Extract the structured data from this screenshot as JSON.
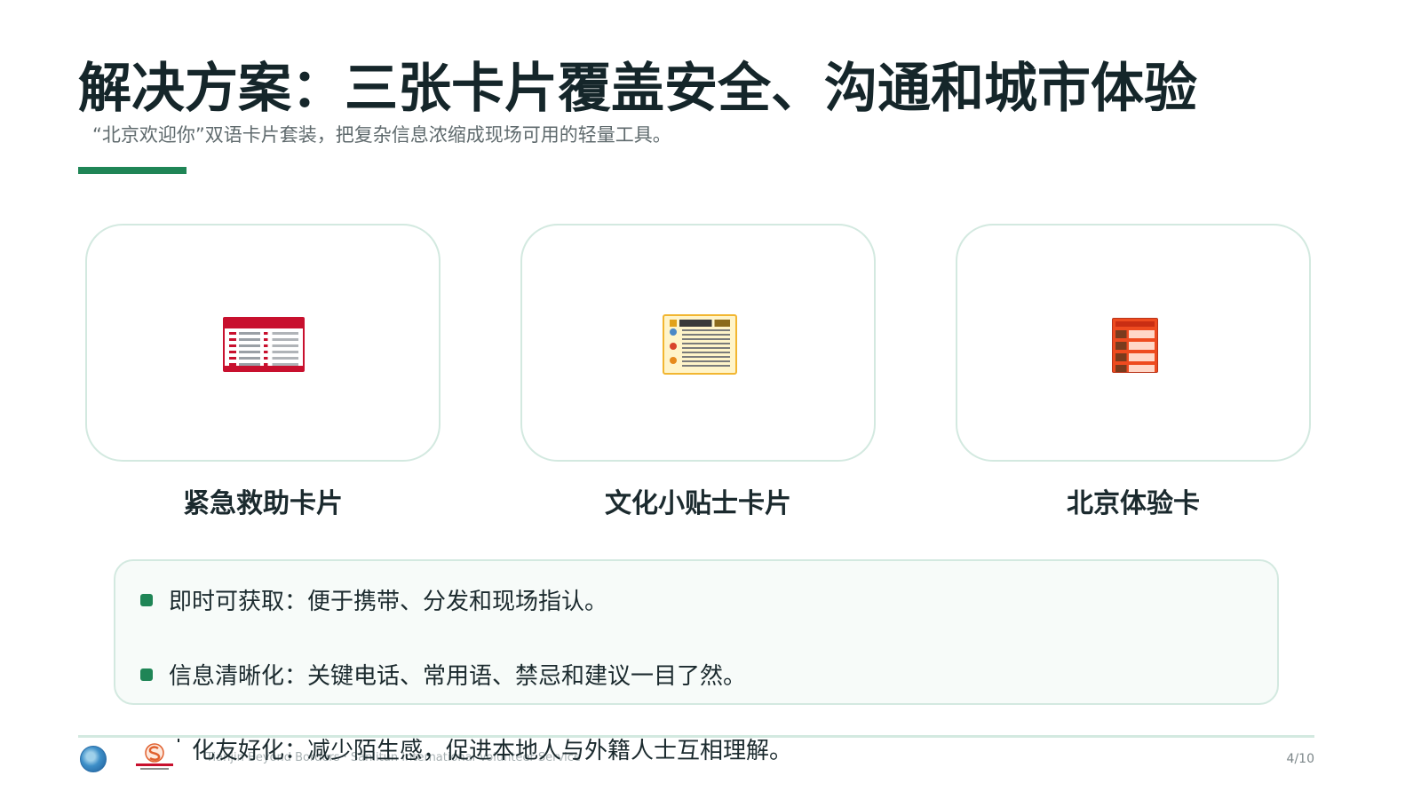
{
  "slide": {
    "title": "解决方案：三张卡片覆盖安全、沟通和城市体验",
    "subtitle": "“北京欢迎你”双语卡片套装，把复杂信息浓缩成现场可用的轻量工具。"
  },
  "cards": [
    {
      "label": "紧急救助卡片"
    },
    {
      "label": "文化小贴士卡片"
    },
    {
      "label": "北京体验卡"
    }
  ],
  "benefits": [
    {
      "text": "即时可获取：便于携带、分发和现场指认。"
    },
    {
      "text": "信息清晰化：关键电话、常用语、禁忌和建议一目了然。"
    }
  ],
  "overflow_benefit": {
    "text": "化友好化：减少陌生感，促进本地人与外籍人士互相理解。"
  },
  "footer": {
    "text": "Tianjin Beyond Borders · Sanlitun International Volunteer Service",
    "page_number": "4/10"
  },
  "colors": {
    "accent": "#1f8556",
    "card_border": "#d3e9e0",
    "emergency_red": "#c8102e",
    "cultural_yellow": "#f2b631",
    "beijing_orange": "#ee4b1f"
  }
}
